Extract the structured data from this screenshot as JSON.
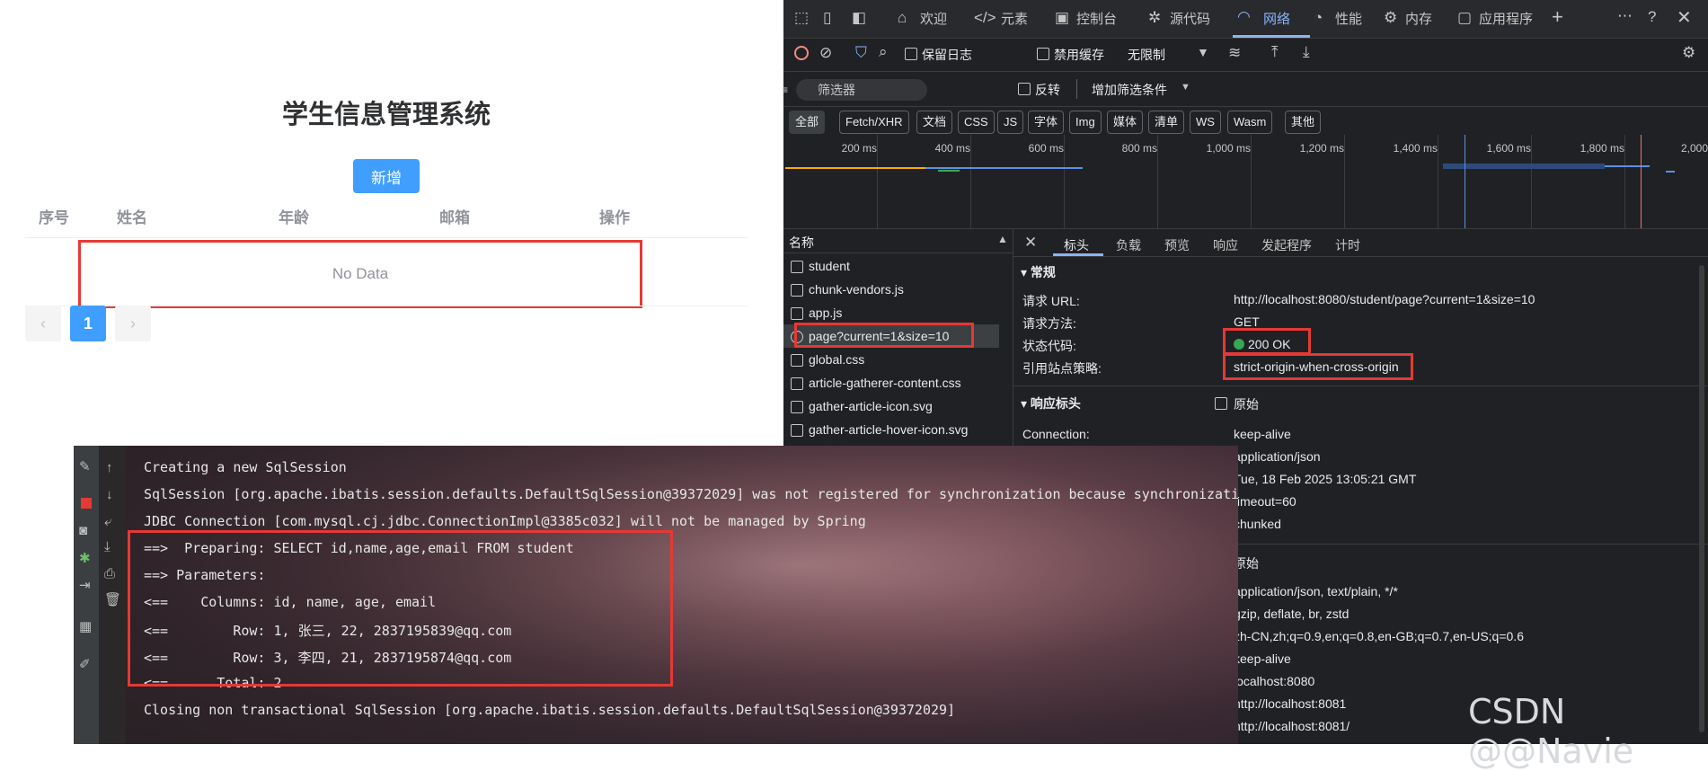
{
  "app": {
    "title": "学生信息管理系统",
    "add_button": "新增",
    "columns": [
      "序号",
      "姓名",
      "年龄",
      "邮箱",
      "操作"
    ],
    "empty_text": "No Data",
    "pagination": {
      "prev": "‹",
      "page": "1",
      "next": "›"
    }
  },
  "devtools": {
    "tabs": [
      "欢迎",
      "元素",
      "控制台",
      "源代码",
      "网络",
      "性能",
      "内存",
      "应用程序"
    ],
    "selected_tab": "网络",
    "toolbar": {
      "preserve_log": "保留日志",
      "disable_cache": "禁用缓存",
      "throttle": "无限制"
    },
    "filter": {
      "placeholder": "筛选器",
      "invert": "反转",
      "more_filters": "增加筛选条件"
    },
    "type_chips": [
      "全部",
      "Fetch/XHR",
      "文档",
      "CSS",
      "JS",
      "字体",
      "Img",
      "媒体",
      "清单",
      "WS",
      "Wasm",
      "其他"
    ],
    "timeline_ticks": [
      "200 ms",
      "400 ms",
      "600 ms",
      "800 ms",
      "1,000 ms",
      "1,200 ms",
      "1,400 ms",
      "1,600 ms",
      "1,800 ms",
      "2,000"
    ],
    "name_header": "名称",
    "requests": [
      "student",
      "chunk-vendors.js",
      "app.js",
      "page?current=1&size=10",
      "global.css",
      "article-gatherer-content.css",
      "gather-article-icon.svg",
      "gather-article-hover-icon.svg"
    ],
    "selected_request": "page?current=1&size=10",
    "detail_tabs": [
      "标头",
      "负载",
      "预览",
      "响应",
      "发起程序",
      "计时"
    ],
    "general": {
      "section": "常规",
      "url_key": "请求 URL:",
      "url_val": "http://localhost:8080/student/page?current=1&size=10",
      "method_key": "请求方法:",
      "method_val": "GET",
      "status_key": "状态代码:",
      "status_val": "200 OK",
      "policy_key": "引用站点策略:",
      "policy_val": "strict-origin-when-cross-origin"
    },
    "response_headers": {
      "section": "响应标头",
      "raw": "原始",
      "rows": [
        {
          "k": "Connection:",
          "v": "keep-alive"
        },
        {
          "k": "",
          "v": "application/json"
        },
        {
          "k": "",
          "v": "Tue, 18 Feb 2025 13:05:21 GMT"
        },
        {
          "k": "",
          "v": "timeout=60"
        },
        {
          "k": "",
          "v": "chunked"
        }
      ]
    },
    "request_headers": {
      "raw": "原始",
      "values": [
        "application/json, text/plain, */*",
        "gzip, deflate, br, zstd",
        "zh-CN,zh;q=0.9,en;q=0.8,en-GB;q=0.7,en-US;q=0.6",
        "keep-alive",
        "localhost:8080",
        "http://localhost:8081",
        "http://localhost:8081/"
      ]
    }
  },
  "console": {
    "lines": [
      "Creating a new SqlSession",
      "SqlSession [org.apache.ibatis.session.defaults.DefaultSqlSession@39372029] was not registered for synchronization because synchronizatio",
      "JDBC Connection [com.mysql.cj.jdbc.ConnectionImpl@3385c032] will not be managed by Spring",
      "==>  Preparing: SELECT id,name,age,email FROM student",
      "==> Parameters: ",
      "<==    Columns: id, name, age, email",
      "<==        Row: 1, 张三, 22, 2837195839@qq.com",
      "<==        Row: 3, 李四, 21, 2837195874@qq.com",
      "<==      Total: 2",
      "Closing non transactional SqlSession [org.apache.ibatis.session.defaults.DefaultSqlSession@39372029]"
    ]
  },
  "watermark": "CSDN @@Navie"
}
